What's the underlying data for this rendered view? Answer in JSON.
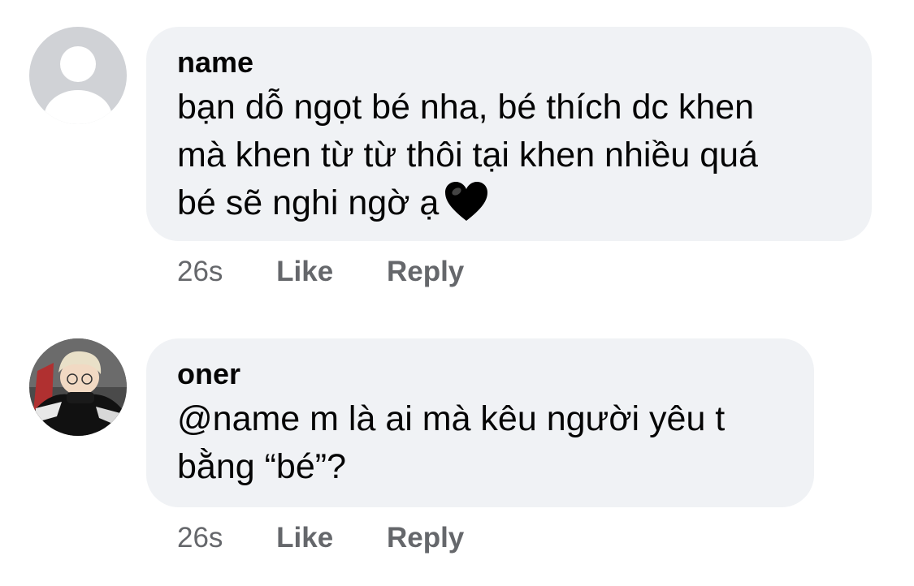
{
  "comments": [
    {
      "author": "name",
      "line1": "bạn dỗ ngọt bé nha, bé thích dc khen",
      "line2": "mà khen từ từ thôi tại khen nhiều quá",
      "line3": "bé sẽ nghi ngờ ạ",
      "emoji": "black-heart-icon",
      "time": "26s",
      "like_label": "Like",
      "reply_label": "Reply"
    },
    {
      "author": "oner",
      "line1": "@name m là ai mà kêu người yêu t",
      "line2": "bằng “bé”?",
      "time": "26s",
      "like_label": "Like",
      "reply_label": "Reply"
    }
  ],
  "colors": {
    "bubble": "#f0f2f5",
    "text": "#050505",
    "meta": "#65676b"
  }
}
